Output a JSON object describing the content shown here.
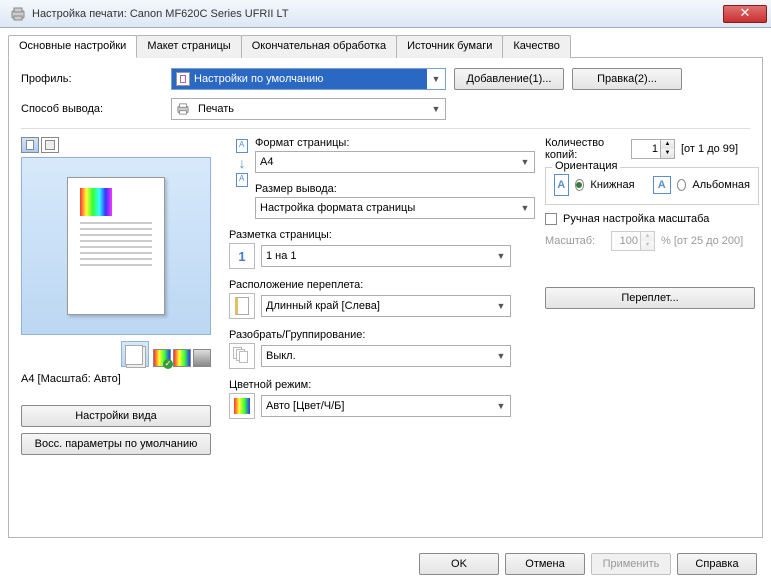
{
  "window": {
    "title": "Настройка печати: Canon MF620C Series UFRII LT"
  },
  "tabs": [
    "Основные настройки",
    "Макет страницы",
    "Окончательная обработка",
    "Источник бумаги",
    "Качество"
  ],
  "profile": {
    "label": "Профиль:",
    "value": "Настройки по умолчанию",
    "add_btn": "Добавление(1)...",
    "edit_btn": "Правка(2)..."
  },
  "output": {
    "label": "Способ вывода:",
    "value": "Печать"
  },
  "preview": {
    "caption": "A4 [Масштаб: Авто]",
    "view_settings_btn": "Настройки вида",
    "restore_defaults_btn": "Восс. параметры по умолчанию"
  },
  "settings": {
    "page_format": {
      "label": "Формат страницы:",
      "value": "A4"
    },
    "output_size": {
      "label": "Размер вывода:",
      "value": "Настройка формата страницы"
    },
    "page_layout": {
      "label": "Разметка страницы:",
      "value": "1 на 1",
      "num": "1"
    },
    "binding": {
      "label": "Расположение переплета:",
      "value": "Длинный край [Слева]"
    },
    "collate": {
      "label": "Разобрать/Группирование:",
      "value": "Выкл."
    },
    "color_mode": {
      "label": "Цветной режим:",
      "value": "Авто [Цвет/Ч/Б]"
    }
  },
  "right": {
    "copies_label": "Количество копий:",
    "copies_value": "1",
    "copies_range": "[от 1 до 99]",
    "orientation_label": "Ориентация",
    "portrait": "Книжная",
    "landscape": "Альбомная",
    "manual_scale": "Ручная настройка масштаба",
    "scale_label": "Масштаб:",
    "scale_value": "100",
    "scale_range": "% [от 25 до 200]",
    "gutter_btn": "Переплет..."
  },
  "buttons": {
    "ok": "OK",
    "cancel": "Отмена",
    "apply": "Применить",
    "help": "Справка"
  }
}
